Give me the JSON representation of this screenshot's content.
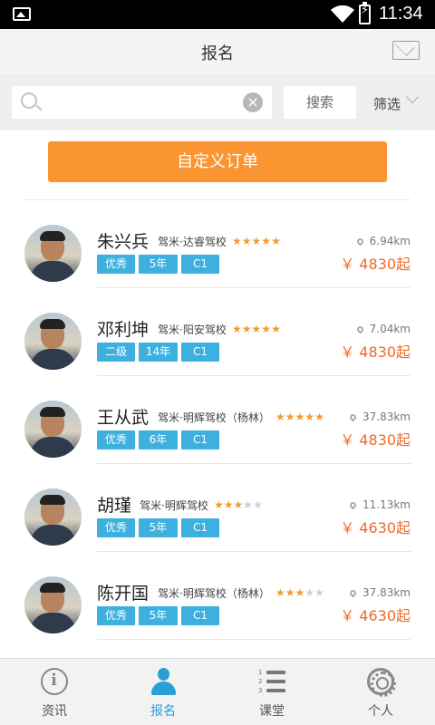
{
  "status_bar": {
    "time": "11:34",
    "battery_icon": "battery-charging-icon",
    "wifi_icon": "wifi-icon",
    "gallery_icon": "image-notification-icon"
  },
  "header": {
    "title": "报名",
    "mail_icon": "mail-icon"
  },
  "search": {
    "placeholder": "",
    "value": "",
    "button_label": "搜索",
    "filter_label": "筛选"
  },
  "custom_order": {
    "label": "自定义订单"
  },
  "instructors": [
    {
      "name": "朱兴兵",
      "school": "驾米·达睿驾校",
      "rating": 5,
      "tags": [
        "优秀",
        "5年",
        "C1"
      ],
      "distance": "6.94km",
      "price": "￥ 4830起"
    },
    {
      "name": "邓利坤",
      "school": "驾米·阳安驾校",
      "rating": 5,
      "tags": [
        "二级",
        "14年",
        "C1"
      ],
      "distance": "7.04km",
      "price": "￥ 4830起"
    },
    {
      "name": "王从武",
      "school": "驾米·明辉驾校（杨林）",
      "rating": 5,
      "tags": [
        "优秀",
        "6年",
        "C1"
      ],
      "distance": "37.83km",
      "price": "￥ 4830起"
    },
    {
      "name": "胡瑾",
      "school": "驾米·明辉驾校",
      "rating": 3,
      "tags": [
        "优秀",
        "5年",
        "C1"
      ],
      "distance": "11.13km",
      "price": "￥ 4630起"
    },
    {
      "name": "陈开国",
      "school": "驾米·明辉驾校（杨林）",
      "rating": 3,
      "tags": [
        "优秀",
        "5年",
        "C1"
      ],
      "distance": "37.83km",
      "price": "￥ 4630起"
    }
  ],
  "tabs": [
    {
      "label": "资讯",
      "icon": "info-icon",
      "active": false
    },
    {
      "label": "报名",
      "icon": "person-icon",
      "active": true
    },
    {
      "label": "课堂",
      "icon": "numbered-list-icon",
      "active": false
    },
    {
      "label": "个人",
      "icon": "gear-icon",
      "active": false
    }
  ],
  "colors": {
    "accent_blue": "#2a9fd6",
    "tag_blue": "#3db0df",
    "orange_button": "#fa9531",
    "price_orange": "#f16b26",
    "star": "#f29b32"
  }
}
